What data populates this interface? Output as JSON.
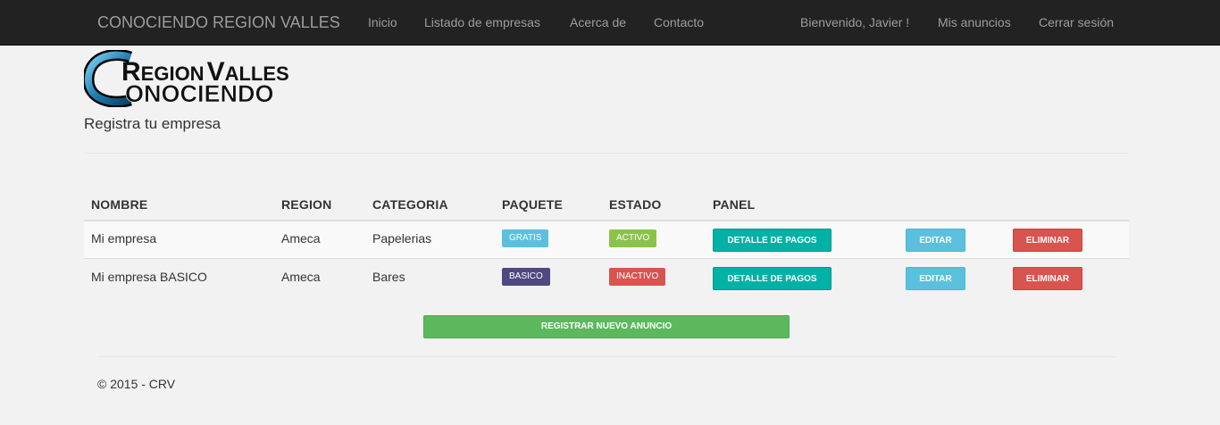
{
  "navbar": {
    "brand": "CONOCIENDO REGION VALLES",
    "links": [
      "Inicio",
      "Listado de empresas",
      "Acerca de",
      "Contacto"
    ],
    "welcome": "Bienvenido, Javier !",
    "my_ads": "Mis anuncios",
    "logout": "Cerrar sesión"
  },
  "logo": {
    "line1_a": "R",
    "line1_b": "EGION",
    "line1_c": "V",
    "line1_d": "ALLES",
    "line2": "ONOCIENDO",
    "initial": "C"
  },
  "page": {
    "subtitle": "Registra tu empresa"
  },
  "table": {
    "headers": [
      "NOMBRE",
      "REGION",
      "CATEGORIA",
      "PAQUETE",
      "ESTADO",
      "PANEL"
    ],
    "rows": [
      {
        "nombre": "Mi empresa",
        "region": "Ameca",
        "categoria": "Papelerias",
        "paquete": "GRATIS",
        "estado": "ACTIVO",
        "pagos": "DETALLE DE PAGOS",
        "editar": "EDITAR",
        "eliminar": "ELIMINAR"
      },
      {
        "nombre": "Mi empresa BASICO",
        "region": "Ameca",
        "categoria": "Bares",
        "paquete": "BASICO",
        "estado": "INACTIVO",
        "pagos": "DETALLE DE PAGOS",
        "editar": "EDITAR",
        "eliminar": "ELIMINAR"
      }
    ]
  },
  "actions": {
    "register": "REGISTRAR NUEVO ANUNCIO"
  },
  "footer": {
    "text": "© 2015 - CRV"
  },
  "colors": {
    "navbar": "#222222",
    "gratis": "#5bc0de",
    "activo": "#8bc34a",
    "basico": "#4e4883",
    "inactivo": "#d9534f",
    "pagos": "#00b1a6",
    "editar": "#5bc0de",
    "eliminar": "#d9534f",
    "registrar": "#5cb85c"
  }
}
